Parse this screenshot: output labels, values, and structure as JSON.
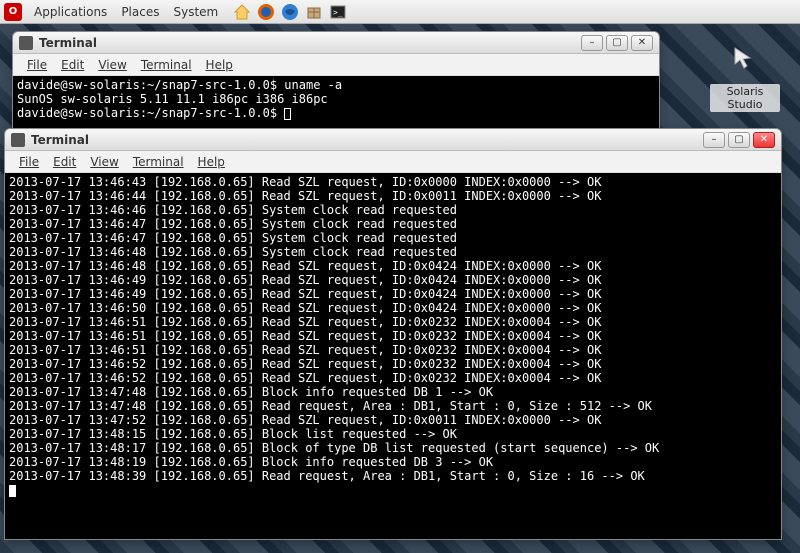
{
  "panel": {
    "menus": [
      "Applications",
      "Places",
      "System"
    ]
  },
  "desktop_icon": {
    "label": "Solaris Studio"
  },
  "win1": {
    "title": "Terminal",
    "menu": [
      "File",
      "Edit",
      "View",
      "Terminal",
      "Help"
    ],
    "lines": [
      "davide@sw-solaris:~/snap7-src-1.0.0$ uname -a",
      "SunOS sw-solaris 5.11 11.1 i86pc i386 i86pc",
      "davide@sw-solaris:~/snap7-src-1.0.0$ "
    ]
  },
  "win2": {
    "title": "Terminal",
    "menu": [
      "File",
      "Edit",
      "View",
      "Terminal",
      "Help"
    ],
    "lines": [
      "2013-07-17 13:46:43 [192.168.0.65] Read SZL request, ID:0x0000 INDEX:0x0000 --> OK",
      "2013-07-17 13:46:44 [192.168.0.65] Read SZL request, ID:0x0011 INDEX:0x0000 --> OK",
      "2013-07-17 13:46:46 [192.168.0.65] System clock read requested",
      "2013-07-17 13:46:47 [192.168.0.65] System clock read requested",
      "2013-07-17 13:46:47 [192.168.0.65] System clock read requested",
      "2013-07-17 13:46:48 [192.168.0.65] System clock read requested",
      "2013-07-17 13:46:48 [192.168.0.65] Read SZL request, ID:0x0424 INDEX:0x0000 --> OK",
      "2013-07-17 13:46:49 [192.168.0.65] Read SZL request, ID:0x0424 INDEX:0x0000 --> OK",
      "2013-07-17 13:46:49 [192.168.0.65] Read SZL request, ID:0x0424 INDEX:0x0000 --> OK",
      "2013-07-17 13:46:50 [192.168.0.65] Read SZL request, ID:0x0424 INDEX:0x0000 --> OK",
      "2013-07-17 13:46:51 [192.168.0.65] Read SZL request, ID:0x0232 INDEX:0x0004 --> OK",
      "2013-07-17 13:46:51 [192.168.0.65] Read SZL request, ID:0x0232 INDEX:0x0004 --> OK",
      "2013-07-17 13:46:51 [192.168.0.65] Read SZL request, ID:0x0232 INDEX:0x0004 --> OK",
      "2013-07-17 13:46:52 [192.168.0.65] Read SZL request, ID:0x0232 INDEX:0x0004 --> OK",
      "2013-07-17 13:46:52 [192.168.0.65] Read SZL request, ID:0x0232 INDEX:0x0004 --> OK",
      "2013-07-17 13:47:48 [192.168.0.65] Block info requested DB 1 --> OK",
      "2013-07-17 13:47:48 [192.168.0.65] Read request, Area : DB1, Start : 0, Size : 512 --> OK",
      "2013-07-17 13:47:52 [192.168.0.65] Read SZL request, ID:0x0011 INDEX:0x0000 --> OK",
      "2013-07-17 13:48:15 [192.168.0.65] Block list requested --> OK",
      "2013-07-17 13:48:17 [192.168.0.65] Block of type DB list requested (start sequence) --> OK",
      "2013-07-17 13:48:19 [192.168.0.65] Block info requested DB 3 --> OK",
      "2013-07-17 13:48:39 [192.168.0.65] Read request, Area : DB1, Start : 0, Size : 16 --> OK"
    ]
  }
}
